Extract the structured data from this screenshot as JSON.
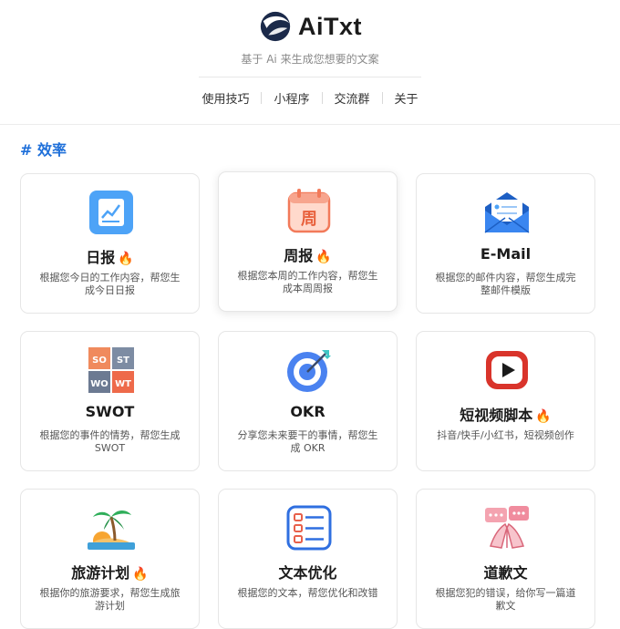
{
  "header": {
    "app_name": "AiTxt",
    "subtitle": "基于 Ai 来生成您想要的文案",
    "nav": [
      "使用技巧",
      "小程序",
      "交流群",
      "关于"
    ]
  },
  "section": {
    "title": "# 效率"
  },
  "cards": [
    {
      "title": "日报",
      "hot": true,
      "desc": "根据您今日的工作内容，帮您生成今日日报",
      "icon": "daily-report-icon"
    },
    {
      "title": "周报",
      "hot": true,
      "desc": "根据您本周的工作内容，帮您生成本周周报",
      "icon": "weekly-calendar-icon"
    },
    {
      "title": "E-Mail",
      "hot": false,
      "desc": "根据您的邮件内容，帮您生成完整邮件模版",
      "icon": "mail-envelope-icon"
    },
    {
      "title": "SWOT",
      "hot": false,
      "desc": "根据您的事件的情势，帮您生成 SWOT",
      "icon": "swot-grid-icon",
      "icon_text": [
        "SO",
        "ST",
        "WO",
        "WT"
      ]
    },
    {
      "title": "OKR",
      "hot": false,
      "desc": "分享您未来要干的事情，帮您生成 OKR",
      "icon": "target-dart-icon"
    },
    {
      "title": "短视频脚本",
      "hot": true,
      "desc": "抖音/快手/小红书，短视频创作",
      "icon": "video-play-icon"
    },
    {
      "title": "旅游计划",
      "hot": true,
      "desc": "根据你的旅游要求，帮您生成旅游计划",
      "icon": "palm-island-icon"
    },
    {
      "title": "文本优化",
      "hot": false,
      "desc": "根据您的文本，帮您优化和改错",
      "icon": "text-list-icon"
    },
    {
      "title": "道歉文",
      "hot": false,
      "desc": "根据您犯的错误，给你写一篇道歉文",
      "icon": "apology-hands-icon"
    }
  ],
  "colors": {
    "accent": "#1e6fd9",
    "fire": "#ff6a00"
  }
}
